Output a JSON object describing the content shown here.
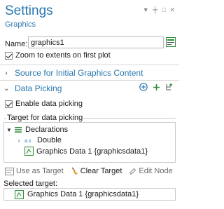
{
  "header": {
    "title": "Settings",
    "subtitle": "Graphics"
  },
  "name_field": {
    "label": "Name:",
    "value": "graphics1"
  },
  "zoom_checkbox": {
    "label": "Zoom to extents on first plot",
    "checked": true
  },
  "sections": {
    "source": {
      "label": "Source for Initial Graphics Content",
      "expanded": false
    },
    "picking": {
      "label": "Data Picking",
      "expanded": true
    }
  },
  "enable_checkbox": {
    "label": "Enable data picking",
    "checked": true
  },
  "target_group": {
    "label": "Target for data picking",
    "tree": [
      {
        "label": "Declarations",
        "expanded": true,
        "level": 0
      },
      {
        "label": "Double",
        "expanded": false,
        "level": 1
      },
      {
        "label": "Graphics Data 1 {graphicsdata1}",
        "level": 1
      }
    ]
  },
  "toolbar": {
    "use_as_target": "Use as Target",
    "clear_target": "Clear Target",
    "edit_node": "Edit Node"
  },
  "selected_target": {
    "label": "Selected target:",
    "value": "Graphics Data 1 {graphicsdata1}"
  },
  "colors": {
    "accent": "#2a78b0",
    "icon_green": "#2e8b3a"
  }
}
